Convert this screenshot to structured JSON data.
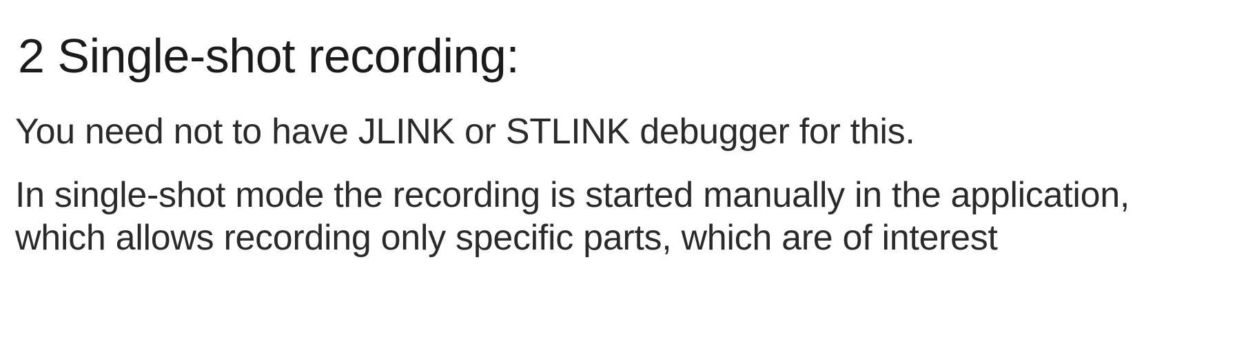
{
  "slide": {
    "title": "2 Single-shot recording:",
    "paragraphs": [
      "You need not to have JLINK or STLINK debugger for this.",
      "In single-shot mode the recording is started manually in the application, which allows recording only specific parts, which are of interest"
    ]
  }
}
